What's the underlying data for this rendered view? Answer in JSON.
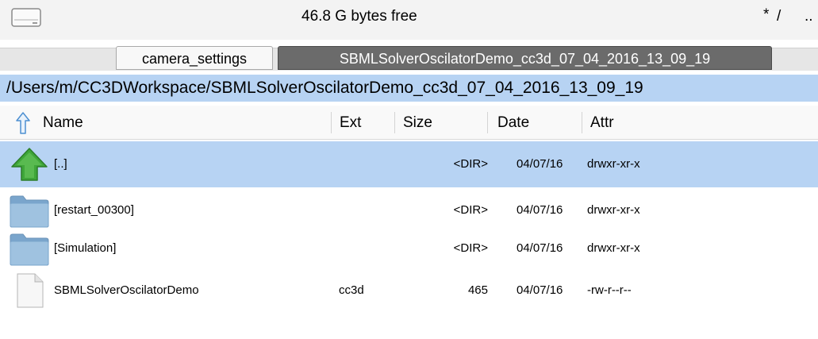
{
  "topbar": {
    "free_space": "46.8 G bytes free",
    "nav_root": "*",
    "nav_slash": "/",
    "nav_up": ".."
  },
  "tabs": [
    {
      "label": "camera_settings",
      "active": false
    },
    {
      "label": "SBMLSolverOscilatorDemo_cc3d_07_04_2016_13_09_19",
      "active": true
    }
  ],
  "path": "/Users/m/CC3DWorkspace/SBMLSolverOscilatorDemo_cc3d_07_04_2016_13_09_19",
  "columns": {
    "name": "Name",
    "ext": "Ext",
    "size": "Size",
    "date": "Date",
    "attr": "Attr"
  },
  "rows": [
    {
      "icon": "up-arrow-icon",
      "name": "[..]",
      "ext": "",
      "size": "<DIR>",
      "date": "04/07/16",
      "attr": "drwxr-xr-x",
      "selected": true
    },
    {
      "icon": "folder-icon",
      "name": "[restart_00300]",
      "ext": "",
      "size": "<DIR>",
      "date": "04/07/16",
      "attr": "drwxr-xr-x",
      "selected": false
    },
    {
      "icon": "folder-icon",
      "name": "[Simulation]",
      "ext": "",
      "size": "<DIR>",
      "date": "04/07/16",
      "attr": "drwxr-xr-x",
      "selected": false
    },
    {
      "icon": "file-icon",
      "name": "SBMLSolverOscilatorDemo",
      "ext": "cc3d",
      "size": "465",
      "date": "04/07/16",
      "attr": "-rw-r--r--",
      "selected": false
    }
  ],
  "colors": {
    "selection": "#b7d3f3",
    "active_tab": "#6b6b6b",
    "arrow_green": "#3fa63a",
    "folder_blue": "#8fb3d3"
  }
}
